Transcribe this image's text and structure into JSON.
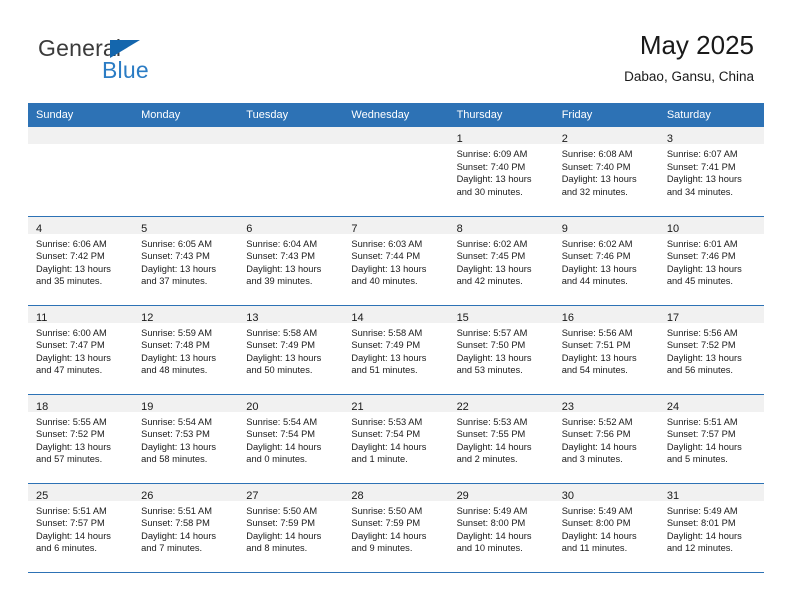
{
  "brand": {
    "name_top": "General",
    "name_bottom": "Blue",
    "triangle_color": "#1466ad",
    "blue_text_color": "#2b7cc4"
  },
  "header": {
    "title": "May 2025",
    "location": "Dabao, Gansu, China"
  },
  "theme": {
    "header_blue": "#2d72b5",
    "daystrip_gray": "#f1f1f1",
    "text_color": "#1a1a1a"
  },
  "weekday_headers": [
    "Sunday",
    "Monday",
    "Tuesday",
    "Wednesday",
    "Thursday",
    "Friday",
    "Saturday"
  ],
  "weeks": [
    [
      {
        "day": "",
        "empty": true,
        "sunrise": "",
        "sunset": "",
        "daylight1": "",
        "daylight2": ""
      },
      {
        "day": "",
        "empty": true,
        "sunrise": "",
        "sunset": "",
        "daylight1": "",
        "daylight2": ""
      },
      {
        "day": "",
        "empty": true,
        "sunrise": "",
        "sunset": "",
        "daylight1": "",
        "daylight2": ""
      },
      {
        "day": "",
        "empty": true,
        "sunrise": "",
        "sunset": "",
        "daylight1": "",
        "daylight2": ""
      },
      {
        "day": "1",
        "empty": false,
        "sunrise": "Sunrise: 6:09 AM",
        "sunset": "Sunset: 7:40 PM",
        "daylight1": "Daylight: 13 hours",
        "daylight2": "and 30 minutes."
      },
      {
        "day": "2",
        "empty": false,
        "sunrise": "Sunrise: 6:08 AM",
        "sunset": "Sunset: 7:40 PM",
        "daylight1": "Daylight: 13 hours",
        "daylight2": "and 32 minutes."
      },
      {
        "day": "3",
        "empty": false,
        "sunrise": "Sunrise: 6:07 AM",
        "sunset": "Sunset: 7:41 PM",
        "daylight1": "Daylight: 13 hours",
        "daylight2": "and 34 minutes."
      }
    ],
    [
      {
        "day": "4",
        "empty": false,
        "sunrise": "Sunrise: 6:06 AM",
        "sunset": "Sunset: 7:42 PM",
        "daylight1": "Daylight: 13 hours",
        "daylight2": "and 35 minutes."
      },
      {
        "day": "5",
        "empty": false,
        "sunrise": "Sunrise: 6:05 AM",
        "sunset": "Sunset: 7:43 PM",
        "daylight1": "Daylight: 13 hours",
        "daylight2": "and 37 minutes."
      },
      {
        "day": "6",
        "empty": false,
        "sunrise": "Sunrise: 6:04 AM",
        "sunset": "Sunset: 7:43 PM",
        "daylight1": "Daylight: 13 hours",
        "daylight2": "and 39 minutes."
      },
      {
        "day": "7",
        "empty": false,
        "sunrise": "Sunrise: 6:03 AM",
        "sunset": "Sunset: 7:44 PM",
        "daylight1": "Daylight: 13 hours",
        "daylight2": "and 40 minutes."
      },
      {
        "day": "8",
        "empty": false,
        "sunrise": "Sunrise: 6:02 AM",
        "sunset": "Sunset: 7:45 PM",
        "daylight1": "Daylight: 13 hours",
        "daylight2": "and 42 minutes."
      },
      {
        "day": "9",
        "empty": false,
        "sunrise": "Sunrise: 6:02 AM",
        "sunset": "Sunset: 7:46 PM",
        "daylight1": "Daylight: 13 hours",
        "daylight2": "and 44 minutes."
      },
      {
        "day": "10",
        "empty": false,
        "sunrise": "Sunrise: 6:01 AM",
        "sunset": "Sunset: 7:46 PM",
        "daylight1": "Daylight: 13 hours",
        "daylight2": "and 45 minutes."
      }
    ],
    [
      {
        "day": "11",
        "empty": false,
        "sunrise": "Sunrise: 6:00 AM",
        "sunset": "Sunset: 7:47 PM",
        "daylight1": "Daylight: 13 hours",
        "daylight2": "and 47 minutes."
      },
      {
        "day": "12",
        "empty": false,
        "sunrise": "Sunrise: 5:59 AM",
        "sunset": "Sunset: 7:48 PM",
        "daylight1": "Daylight: 13 hours",
        "daylight2": "and 48 minutes."
      },
      {
        "day": "13",
        "empty": false,
        "sunrise": "Sunrise: 5:58 AM",
        "sunset": "Sunset: 7:49 PM",
        "daylight1": "Daylight: 13 hours",
        "daylight2": "and 50 minutes."
      },
      {
        "day": "14",
        "empty": false,
        "sunrise": "Sunrise: 5:58 AM",
        "sunset": "Sunset: 7:49 PM",
        "daylight1": "Daylight: 13 hours",
        "daylight2": "and 51 minutes."
      },
      {
        "day": "15",
        "empty": false,
        "sunrise": "Sunrise: 5:57 AM",
        "sunset": "Sunset: 7:50 PM",
        "daylight1": "Daylight: 13 hours",
        "daylight2": "and 53 minutes."
      },
      {
        "day": "16",
        "empty": false,
        "sunrise": "Sunrise: 5:56 AM",
        "sunset": "Sunset: 7:51 PM",
        "daylight1": "Daylight: 13 hours",
        "daylight2": "and 54 minutes."
      },
      {
        "day": "17",
        "empty": false,
        "sunrise": "Sunrise: 5:56 AM",
        "sunset": "Sunset: 7:52 PM",
        "daylight1": "Daylight: 13 hours",
        "daylight2": "and 56 minutes."
      }
    ],
    [
      {
        "day": "18",
        "empty": false,
        "sunrise": "Sunrise: 5:55 AM",
        "sunset": "Sunset: 7:52 PM",
        "daylight1": "Daylight: 13 hours",
        "daylight2": "and 57 minutes."
      },
      {
        "day": "19",
        "empty": false,
        "sunrise": "Sunrise: 5:54 AM",
        "sunset": "Sunset: 7:53 PM",
        "daylight1": "Daylight: 13 hours",
        "daylight2": "and 58 minutes."
      },
      {
        "day": "20",
        "empty": false,
        "sunrise": "Sunrise: 5:54 AM",
        "sunset": "Sunset: 7:54 PM",
        "daylight1": "Daylight: 14 hours",
        "daylight2": "and 0 minutes."
      },
      {
        "day": "21",
        "empty": false,
        "sunrise": "Sunrise: 5:53 AM",
        "sunset": "Sunset: 7:54 PM",
        "daylight1": "Daylight: 14 hours",
        "daylight2": "and 1 minute."
      },
      {
        "day": "22",
        "empty": false,
        "sunrise": "Sunrise: 5:53 AM",
        "sunset": "Sunset: 7:55 PM",
        "daylight1": "Daylight: 14 hours",
        "daylight2": "and 2 minutes."
      },
      {
        "day": "23",
        "empty": false,
        "sunrise": "Sunrise: 5:52 AM",
        "sunset": "Sunset: 7:56 PM",
        "daylight1": "Daylight: 14 hours",
        "daylight2": "and 3 minutes."
      },
      {
        "day": "24",
        "empty": false,
        "sunrise": "Sunrise: 5:51 AM",
        "sunset": "Sunset: 7:57 PM",
        "daylight1": "Daylight: 14 hours",
        "daylight2": "and 5 minutes."
      }
    ],
    [
      {
        "day": "25",
        "empty": false,
        "sunrise": "Sunrise: 5:51 AM",
        "sunset": "Sunset: 7:57 PM",
        "daylight1": "Daylight: 14 hours",
        "daylight2": "and 6 minutes."
      },
      {
        "day": "26",
        "empty": false,
        "sunrise": "Sunrise: 5:51 AM",
        "sunset": "Sunset: 7:58 PM",
        "daylight1": "Daylight: 14 hours",
        "daylight2": "and 7 minutes."
      },
      {
        "day": "27",
        "empty": false,
        "sunrise": "Sunrise: 5:50 AM",
        "sunset": "Sunset: 7:59 PM",
        "daylight1": "Daylight: 14 hours",
        "daylight2": "and 8 minutes."
      },
      {
        "day": "28",
        "empty": false,
        "sunrise": "Sunrise: 5:50 AM",
        "sunset": "Sunset: 7:59 PM",
        "daylight1": "Daylight: 14 hours",
        "daylight2": "and 9 minutes."
      },
      {
        "day": "29",
        "empty": false,
        "sunrise": "Sunrise: 5:49 AM",
        "sunset": "Sunset: 8:00 PM",
        "daylight1": "Daylight: 14 hours",
        "daylight2": "and 10 minutes."
      },
      {
        "day": "30",
        "empty": false,
        "sunrise": "Sunrise: 5:49 AM",
        "sunset": "Sunset: 8:00 PM",
        "daylight1": "Daylight: 14 hours",
        "daylight2": "and 11 minutes."
      },
      {
        "day": "31",
        "empty": false,
        "sunrise": "Sunrise: 5:49 AM",
        "sunset": "Sunset: 8:01 PM",
        "daylight1": "Daylight: 14 hours",
        "daylight2": "and 12 minutes."
      }
    ]
  ]
}
